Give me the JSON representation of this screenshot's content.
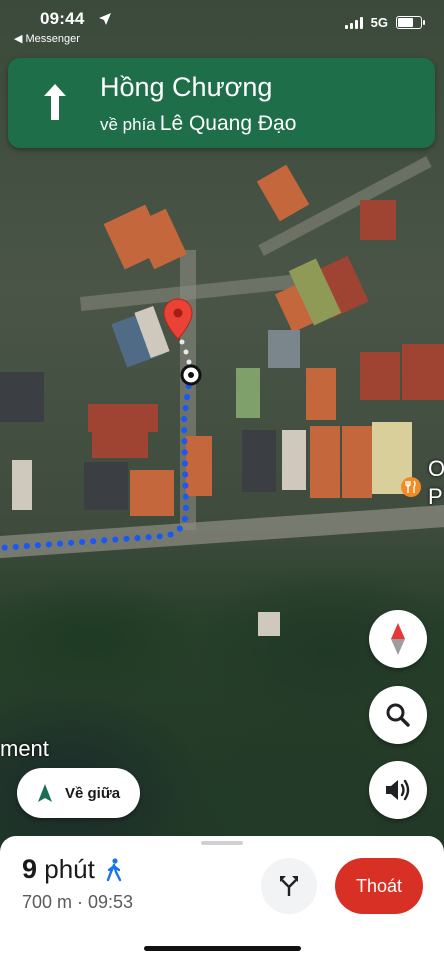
{
  "status_bar": {
    "time": "09:44",
    "back_app": "◀ Messenger",
    "network": "5G",
    "battery_level": 0.7
  },
  "navigation": {
    "street": "Hồng Chương",
    "toward_prefix": "về phía",
    "toward_street": "Lê Quang Đạo",
    "direction_icon": "straight-arrow-icon"
  },
  "map": {
    "partial_label_left": "ment",
    "partial_label_right_1": "O",
    "partial_label_right_2": "P",
    "poi_icon": "restaurant-icon",
    "route_color": "#1a57f5"
  },
  "controls": {
    "compass": "compass-icon",
    "search": "search-icon",
    "sound": "volume-icon",
    "recenter_label": "Về giữa"
  },
  "trip": {
    "minutes_value": "9",
    "minutes_unit": "phút",
    "mode_icon": "walking-icon",
    "details": "700 m · 09:53",
    "exit_label": "Thoát"
  },
  "colors": {
    "nav_green": "#1e6e4a",
    "exit_red": "#d93025",
    "route_blue": "#1a57f5"
  }
}
